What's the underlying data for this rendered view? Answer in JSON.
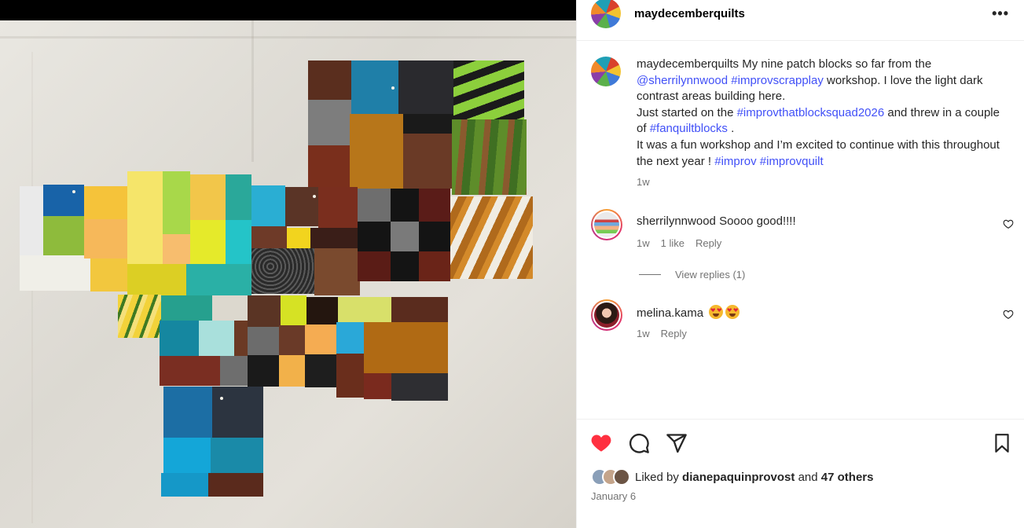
{
  "post": {
    "author": "maydecemberquilts",
    "more_label": "•••"
  },
  "caption": {
    "username": "maydecemberquilts",
    "line1": " My nine patch blocks so far from the",
    "tag_sherri": "@sherrilynnwood",
    "space": " ",
    "tag_improvscrapplay": "#improvscrapplay",
    "line2": " workshop. I love the light dark contrast areas building here.",
    "line3": "Just started on the ",
    "tag_squad": "#improvthatblocksquad2026",
    "line4": " and threw in a couple of ",
    "tag_fan": "#fanquiltblocks",
    "line5": " .",
    "line6": "It was a fun workshop and I’m excited to continue with this throughout the next year ! ",
    "tag_improv": "#improv",
    "tag_improvquilt": "#improvquilt",
    "time": "1w"
  },
  "comments": [
    {
      "username": "sherrilynnwood",
      "text": "Soooo good!!!!",
      "time": "1w",
      "likes": "1 like",
      "reply": "Reply",
      "view_replies": "View replies (1)"
    },
    {
      "username": "melina.kama",
      "text": "",
      "time": "1w",
      "reply": "Reply"
    }
  ],
  "footer": {
    "liked_by_prefix": "Liked by ",
    "liked_by_user": "dianepaquinprovost",
    "liked_by_and": " and ",
    "liked_by_others": "47 others",
    "date": "January 6"
  },
  "icons": {
    "like": "heart-filled-icon",
    "comment": "comment-icon",
    "share": "share-icon",
    "save": "bookmark-icon",
    "comment_like": "heart-outline-icon",
    "emoji": "heart-eyes-emoji-icon"
  },
  "colors": {
    "link": "#4150f7",
    "like_red": "#ff3040",
    "muted": "#737373"
  }
}
